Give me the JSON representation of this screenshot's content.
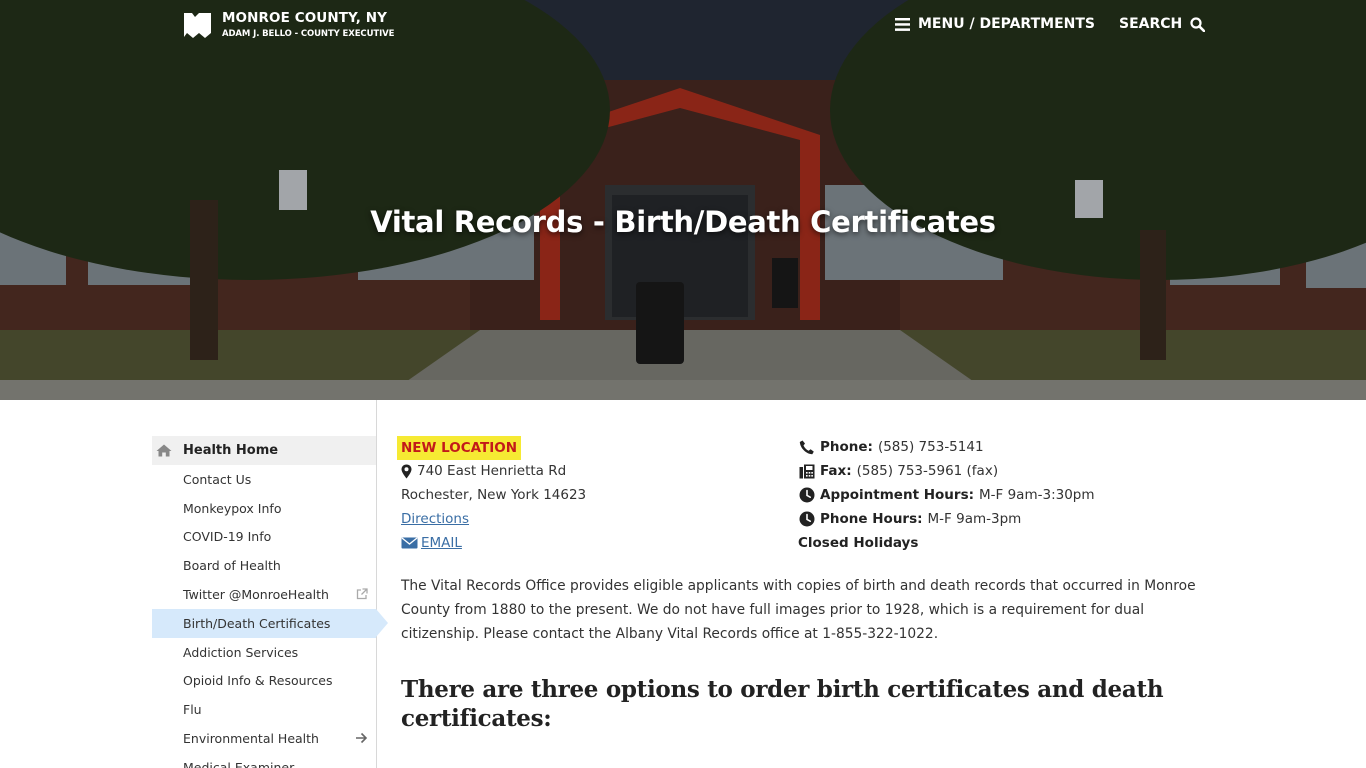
{
  "header": {
    "brand_name": "MONROE COUNTY, NY",
    "brand_sub": "ADAM J. BELLO - COUNTY EXECUTIVE",
    "menu_label": "MENU / DEPARTMENTS",
    "search_label": "SEARCH"
  },
  "hero": {
    "title": "Vital Records - Birth/Death Certificates"
  },
  "sidebar": {
    "home_label": "Health Home",
    "items": [
      {
        "label": "Contact Us"
      },
      {
        "label": "Monkeypox Info"
      },
      {
        "label": "COVID-19 Info"
      },
      {
        "label": "Board of Health"
      },
      {
        "label": "Twitter @MonroeHealth",
        "trail": "external-link-icon"
      },
      {
        "label": "Birth/Death Certificates",
        "active": true
      },
      {
        "label": "Addiction Services"
      },
      {
        "label": "Opioid Info & Resources"
      },
      {
        "label": "Flu"
      },
      {
        "label": "Environmental Health",
        "trail": "arrow-right-icon"
      },
      {
        "label": "Medical Examiner"
      }
    ]
  },
  "location": {
    "badge": "NEW LOCATION",
    "street": "740 East Henrietta Rd",
    "city": "Rochester, New York 14623",
    "directions": "Directions",
    "email": "EMAIL"
  },
  "contact": {
    "phone_label": "Phone:",
    "phone_value": "(585) 753-5141",
    "fax_label": "Fax:",
    "fax_value": "(585) 753-5961 (fax)",
    "appt_label": "Appointment Hours:",
    "appt_value": "M-F 9am-3:30pm",
    "phone_hours_label": "Phone Hours:",
    "phone_hours_value": "M-F 9am-3pm",
    "closed": "Closed Holidays"
  },
  "content": {
    "intro": "The Vital Records Office provides eligible applicants with copies of birth and death records that occurred in Monroe County from 1880 to the present. We do not have full images prior to 1928, which is a requirement for dual citizenship. Please contact the Albany Vital Records office at 1-855-322-1022.",
    "heading": "There are three options to order birth certificates and death certificates:"
  },
  "colors": {
    "badge_bg": "#f6ea33",
    "badge_text": "#c21a1a",
    "link": "#3a6ea5",
    "active_bg": "#d6e9fb"
  }
}
